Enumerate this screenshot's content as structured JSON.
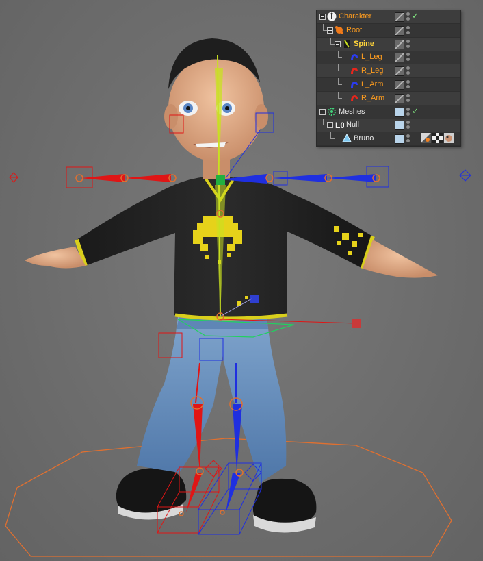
{
  "object_manager": {
    "rows": [
      {
        "label": "Charakter",
        "style": "orange",
        "icon": "character-icon",
        "layer": "hatch",
        "check": true
      },
      {
        "label": "Root",
        "style": "orange",
        "icon": "joint-root-icon",
        "layer": "hatch",
        "check": false
      },
      {
        "label": "Spine",
        "style": "yellow",
        "icon": "spine-joint-icon",
        "layer": "hatch",
        "check": false
      },
      {
        "label": "L_Leg",
        "style": "orange",
        "icon": "blue-limb-icon",
        "layer": "hatch",
        "check": false
      },
      {
        "label": "R_Leg",
        "style": "orange",
        "icon": "red-limb-icon",
        "layer": "hatch",
        "check": false
      },
      {
        "label": "L_Arm",
        "style": "orange",
        "icon": "blue-limb-icon",
        "layer": "hatch",
        "check": false
      },
      {
        "label": "R_Arm",
        "style": "orange",
        "icon": "red-limb-icon",
        "layer": "hatch",
        "check": false
      },
      {
        "label": "Meshes",
        "style": "white",
        "icon": "meshes-null-icon",
        "layer": "light",
        "check": true
      },
      {
        "label": "Null",
        "style": "white",
        "icon": "null-object-icon",
        "layer": "light",
        "check": false
      },
      {
        "label": "Bruno",
        "style": "white",
        "icon": "polygon-object-icon",
        "layer": "light",
        "check": false
      }
    ],
    "check_glyph": "✓",
    "bruno_tags": [
      "phong-tag-icon",
      "material-tag-icon",
      "skin-tag-icon"
    ]
  },
  "colors": {
    "viewport_bg": "#6f6f6f",
    "left_rig": "#e01515",
    "right_rig": "#1f2fe0",
    "spine_rig": "#c8e020",
    "control_orange": "#e07030",
    "accent_yellow": "#e6d21a"
  }
}
